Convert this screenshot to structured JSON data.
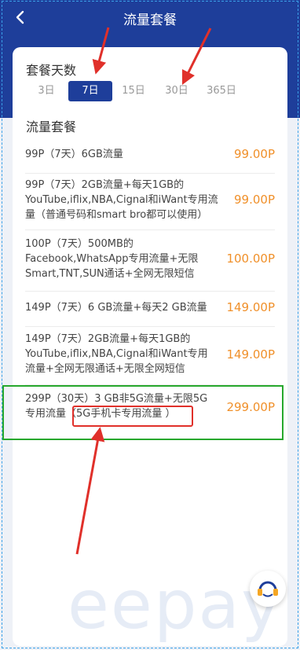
{
  "header": {
    "title": "流量套餐",
    "back_icon": "chevron-left-icon"
  },
  "days_section": {
    "label": "套餐天数"
  },
  "tabs": [
    {
      "label": "3日",
      "active": false
    },
    {
      "label": "7日",
      "active": true
    },
    {
      "label": "15日",
      "active": false
    },
    {
      "label": "30日",
      "active": false
    },
    {
      "label": "365日",
      "active": false
    }
  ],
  "plans_section": {
    "label": "流量套餐"
  },
  "plans": [
    {
      "lines": [
        "99P（7天）6GB流量"
      ],
      "price": "99.00P"
    },
    {
      "lines": [
        "99P（7天）2GB流量+每天1GB的",
        "YouTube,iflix,NBA,Cignal和iWant专用流",
        "量（普通号码和smart bro都可以使用）"
      ],
      "price": "99.00P"
    },
    {
      "lines": [
        "100P（7天）500MB的",
        "Facebook,WhatsApp专用流量+无限",
        "Smart,TNT,SUN通话+全网无限短信"
      ],
      "price": "100.00P"
    },
    {
      "lines": [
        "149P（7天）6 GB流量+每天2 GB流量"
      ],
      "price": "149.00P"
    },
    {
      "lines": [
        "149P（7天）2GB流量+每天1GB的",
        "YouTube,iflix,NBA,Cignal和iWant专用",
        "流量+全网无限通话+无限全网短信"
      ],
      "price": "149.00P"
    },
    {
      "lines": [
        "299P（30天）3 GB非5G流量+无限5G",
        "专用流量（5G手机卡专用流量 ）"
      ],
      "price": "299.00P"
    }
  ],
  "watermark": "eepay",
  "support": {
    "icon": "headset-icon"
  },
  "colors": {
    "brand": "#1e3e9a",
    "price": "#f0902a",
    "annotation_red": "#e0302a",
    "annotation_green": "#27a82d"
  }
}
